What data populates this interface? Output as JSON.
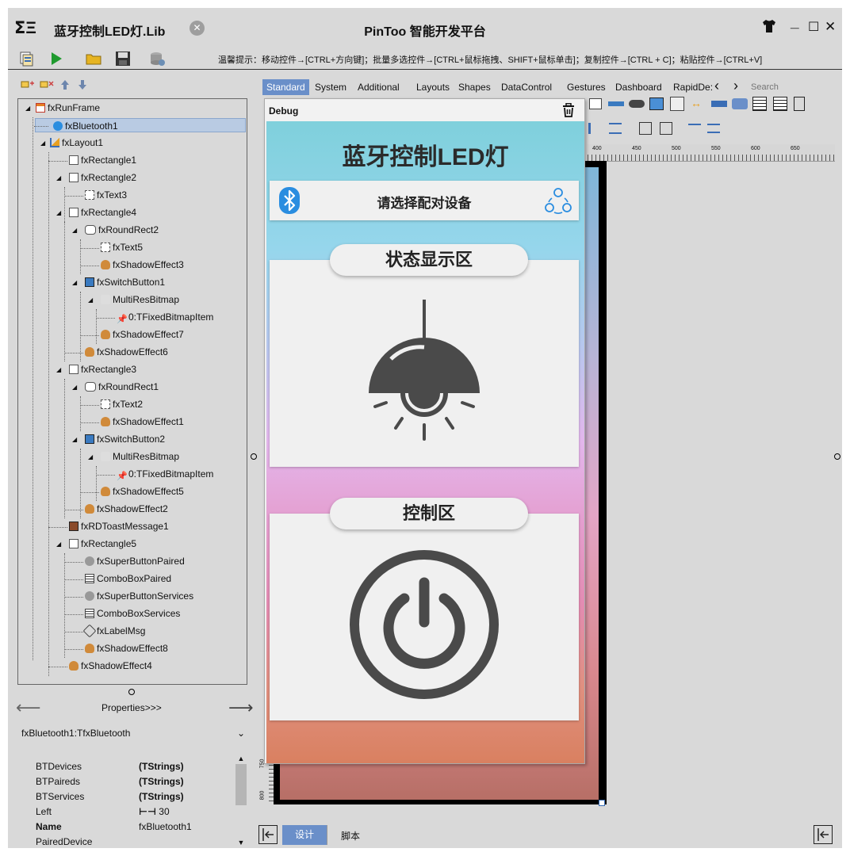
{
  "titlebar": {
    "logo": "ⵉΞ",
    "lib_name": "蓝牙控制LED灯.Lib",
    "close_lib": "✕",
    "app_title": "PinToo 智能开发平台",
    "minimize": "_",
    "maximize": "☐",
    "close": "✕"
  },
  "toolbar": {
    "hint": "温馨提示：移动控件→[CTRL+方向键]；批量多选控件→[CTRL+鼠标拖拽、SHIFT+鼠标单击]；复制控件→[CTRL + C]；粘贴控件→[CTRL+V]"
  },
  "tree": {
    "items": [
      {
        "label": "fxRunFrame"
      },
      {
        "label": "fxBluetooth1"
      },
      {
        "label": "fxLayout1"
      },
      {
        "label": "fxRectangle1"
      },
      {
        "label": "fxRectangle2"
      },
      {
        "label": "fxText3"
      },
      {
        "label": "fxRectangle4"
      },
      {
        "label": "fxRoundRect2"
      },
      {
        "label": "fxText5"
      },
      {
        "label": "fxShadowEffect3"
      },
      {
        "label": "fxSwitchButton1"
      },
      {
        "label": "MultiResBitmap"
      },
      {
        "label": "0:TFixedBitmapItem"
      },
      {
        "label": "fxShadowEffect7"
      },
      {
        "label": "fxShadowEffect6"
      },
      {
        "label": "fxRectangle3"
      },
      {
        "label": "fxRoundRect1"
      },
      {
        "label": "fxText2"
      },
      {
        "label": "fxShadowEffect1"
      },
      {
        "label": "fxSwitchButton2"
      },
      {
        "label": "MultiResBitmap"
      },
      {
        "label": "0:TFixedBitmapItem"
      },
      {
        "label": "fxShadowEffect5"
      },
      {
        "label": "fxShadowEffect2"
      },
      {
        "label": "fxRDToastMessage1"
      },
      {
        "label": "fxRectangle5"
      },
      {
        "label": "fxSuperButtonPaired"
      },
      {
        "label": "ComboBoxPaired"
      },
      {
        "label": "fxSuperButtonServices"
      },
      {
        "label": "ComboBoxServices"
      },
      {
        "label": "fxLabelMsg"
      },
      {
        "label": "fxShadowEffect8"
      },
      {
        "label": "fxShadowEffect4"
      }
    ]
  },
  "props": {
    "nav_label": "Properties>>>",
    "selected": "fxBluetooth1:TfxBluetooth",
    "rows": [
      {
        "name": "BTDevices",
        "value": "(TStrings)"
      },
      {
        "name": "BTPaireds",
        "value": "(TStrings)"
      },
      {
        "name": "BTServices",
        "value": "(TStrings)"
      },
      {
        "name": "Left",
        "value": "30"
      },
      {
        "name": "Name",
        "value": "fxBluetooth1"
      },
      {
        "name": "PairedDevice",
        "value": ""
      }
    ]
  },
  "palette": {
    "tabs": [
      "Standard",
      "System",
      "Additional",
      "Layouts",
      "Shapes",
      "DataControl",
      "Gestures",
      "Dashboard",
      "RapidDe:"
    ],
    "search_placeholder": "Search"
  },
  "ruler": {
    "ticks": [
      "400",
      "450",
      "500",
      "550",
      "600",
      "650"
    ]
  },
  "vruler": {
    "ticks": [
      "800",
      "750"
    ]
  },
  "debug": {
    "title": "Debug"
  },
  "phone": {
    "title": "蓝牙控制LED灯",
    "device_select": "请选择配对设备",
    "status_title": "状态显示区",
    "control_title": "控制区"
  },
  "bottom": {
    "tabs": [
      "设计",
      "脚本"
    ]
  },
  "colors": {
    "window_bg": "#d9d9d9",
    "selected_row": "#b9cbe3",
    "active_tab": "#6a8fc9",
    "icon_gray": "#4a4a4a",
    "bluetooth_blue": "#2a8de0"
  }
}
